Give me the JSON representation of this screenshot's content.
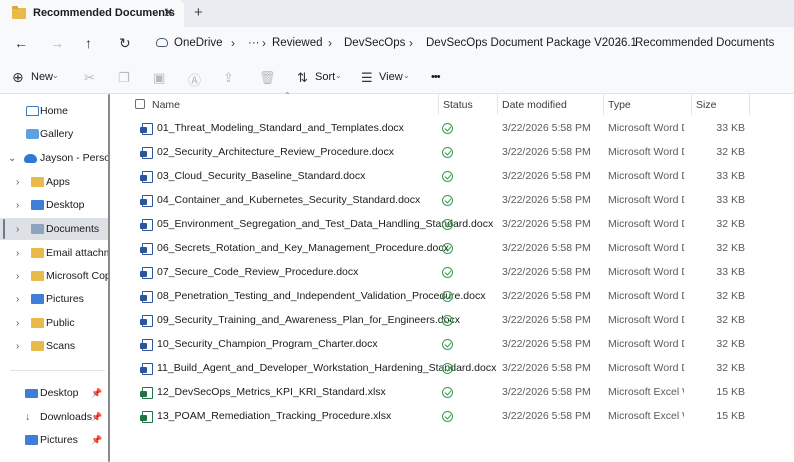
{
  "window": {
    "tab_title": "Recommended Documents",
    "tab_close": "✕",
    "new_tab": "+"
  },
  "nav": {
    "back": "←",
    "forward": "→",
    "up": "↑",
    "refresh": "↻"
  },
  "breadcrumb": {
    "items": [
      "OneDrive",
      "Reviewed",
      "DevSecOps",
      "DevSecOps Document Package V2026.1",
      "Recommended Documents"
    ],
    "overflow": "···",
    "separator": "›"
  },
  "toolbar": {
    "new_label": "New",
    "sort_label": "Sort",
    "view_label": "View",
    "more_label": "•••"
  },
  "sidebar": {
    "items": [
      {
        "label": "Home",
        "icon": "home-icon"
      },
      {
        "label": "Gallery",
        "icon": "gallery-icon"
      },
      {
        "label": "Jayson - Persona",
        "icon": "onedrive-icon"
      },
      {
        "label": "Apps",
        "icon": "folder-icon"
      },
      {
        "label": "Desktop",
        "icon": "folder-icon"
      },
      {
        "label": "Documents",
        "icon": "folder-icon"
      },
      {
        "label": "Email attachm",
        "icon": "folder-icon"
      },
      {
        "label": "Microsoft Copi",
        "icon": "folder-icon"
      },
      {
        "label": "Pictures",
        "icon": "folder-icon"
      },
      {
        "label": "Public",
        "icon": "folder-icon"
      },
      {
        "label": "Scans",
        "icon": "folder-icon"
      }
    ],
    "quick_access": [
      {
        "label": "Desktop",
        "icon": "desktop-icon"
      },
      {
        "label": "Downloads",
        "icon": "downloads-icon"
      },
      {
        "label": "Pictures",
        "icon": "pictures-icon"
      }
    ]
  },
  "columns": {
    "name": "Name",
    "status": "Status",
    "date": "Date modified",
    "type": "Type",
    "size": "Size"
  },
  "files": [
    {
      "name": "01_Threat_Modeling_Standard_and_Templates.docx",
      "date": "3/22/2026 5:58 PM",
      "type": "Microsoft Word D...",
      "size": "33 KB",
      "kind": "word"
    },
    {
      "name": "02_Security_Architecture_Review_Procedure.docx",
      "date": "3/22/2026 5:58 PM",
      "type": "Microsoft Word D...",
      "size": "32 KB",
      "kind": "word"
    },
    {
      "name": "03_Cloud_Security_Baseline_Standard.docx",
      "date": "3/22/2026 5:58 PM",
      "type": "Microsoft Word D...",
      "size": "33 KB",
      "kind": "word"
    },
    {
      "name": "04_Container_and_Kubernetes_Security_Standard.docx",
      "date": "3/22/2026 5:58 PM",
      "type": "Microsoft Word D...",
      "size": "33 KB",
      "kind": "word"
    },
    {
      "name": "05_Environment_Segregation_and_Test_Data_Handling_Standard.docx",
      "date": "3/22/2026 5:58 PM",
      "type": "Microsoft Word D...",
      "size": "32 KB",
      "kind": "word"
    },
    {
      "name": "06_Secrets_Rotation_and_Key_Management_Procedure.docx",
      "date": "3/22/2026 5:58 PM",
      "type": "Microsoft Word D...",
      "size": "32 KB",
      "kind": "word"
    },
    {
      "name": "07_Secure_Code_Review_Procedure.docx",
      "date": "3/22/2026 5:58 PM",
      "type": "Microsoft Word D...",
      "size": "33 KB",
      "kind": "word"
    },
    {
      "name": "08_Penetration_Testing_and_Independent_Validation_Procedure.docx",
      "date": "3/22/2026 5:58 PM",
      "type": "Microsoft Word D...",
      "size": "32 KB",
      "kind": "word"
    },
    {
      "name": "09_Security_Training_and_Awareness_Plan_for_Engineers.docx",
      "date": "3/22/2026 5:58 PM",
      "type": "Microsoft Word D...",
      "size": "32 KB",
      "kind": "word"
    },
    {
      "name": "10_Security_Champion_Program_Charter.docx",
      "date": "3/22/2026 5:58 PM",
      "type": "Microsoft Word D...",
      "size": "32 KB",
      "kind": "word"
    },
    {
      "name": "11_Build_Agent_and_Developer_Workstation_Hardening_Standard.docx",
      "date": "3/22/2026 5:58 PM",
      "type": "Microsoft Word D...",
      "size": "32 KB",
      "kind": "word"
    },
    {
      "name": "12_DevSecOps_Metrics_KPI_KRI_Standard.xlsx",
      "date": "3/22/2026 5:58 PM",
      "type": "Microsoft Excel W...",
      "size": "15 KB",
      "kind": "excel"
    },
    {
      "name": "13_POAM_Remediation_Tracking_Procedure.xlsx",
      "date": "3/22/2026 5:58 PM",
      "type": "Microsoft Excel W...",
      "size": "15 KB",
      "kind": "excel"
    }
  ]
}
